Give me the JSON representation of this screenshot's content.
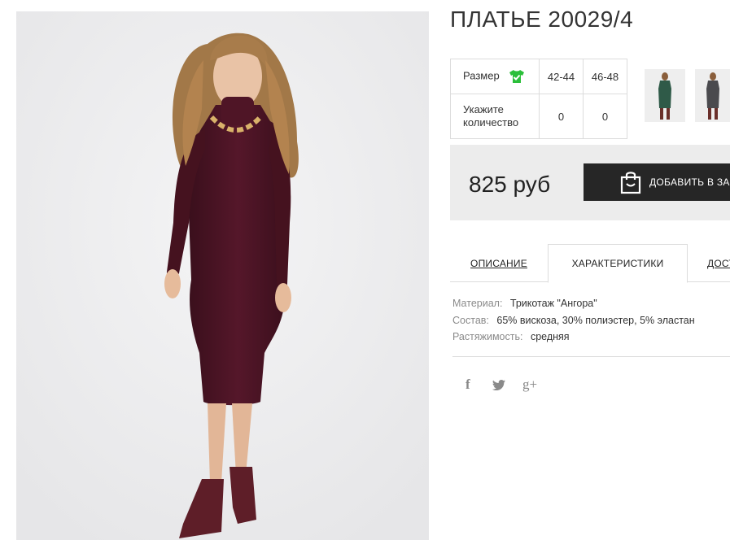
{
  "product": {
    "title": "ПЛАТЬЕ 20029/4",
    "photo_icon": "dress-photo"
  },
  "sizes": {
    "size_label": "Размер",
    "size_icon": "tshirt-check-icon",
    "options": [
      "42-44",
      "46-48"
    ],
    "quantity_label_line1": "Укажите",
    "quantity_label_line2": "количество",
    "quantities": [
      "0",
      "0"
    ]
  },
  "thumbnails": [
    {
      "name": "thumbnail-green-dress",
      "color": "#2f5a48"
    },
    {
      "name": "thumbnail-grey-dress",
      "color": "#4a4a4e"
    }
  ],
  "purchase": {
    "price": "825 руб",
    "add_button_label": "ДОБАВИТЬ В ЗАКАЗ",
    "button_color": "#262626"
  },
  "tabs": {
    "description": "ОПИСАНИЕ",
    "characteristics": "ХАРАКТЕРИСТИКИ",
    "delivery": "ДОСТАВКА"
  },
  "characteristics": {
    "material_label": "Материал:",
    "material_value": "Трикотаж \"Ангора\"",
    "composition_label": "Состав:",
    "composition_value": "65% вискоза, 30% полиэстер, 5% эластан",
    "stretch_label": "Растяжимость:",
    "stretch_value": "средняя"
  },
  "social": {
    "facebook": "f",
    "twitter": "𝕥",
    "google_plus": "g+"
  },
  "colors": {
    "dress": "#4a1424",
    "size_icon": "#2bbf3a"
  }
}
